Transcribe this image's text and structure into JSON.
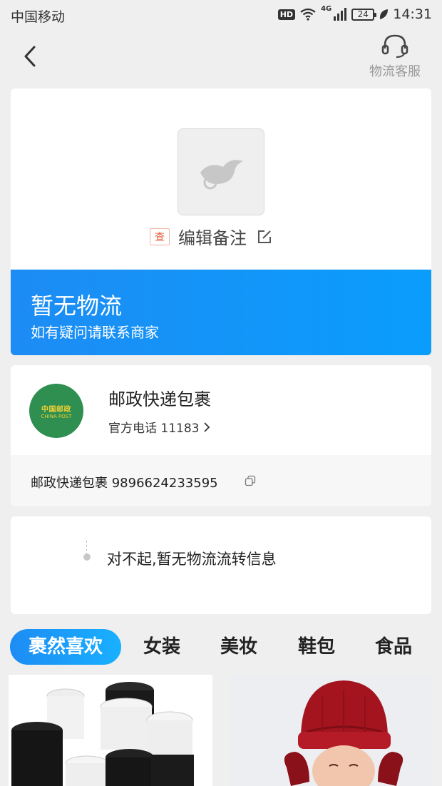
{
  "status_bar": {
    "carrier": "中国移动",
    "hd": "HD",
    "network": "4G",
    "battery": "24",
    "time": "14:31"
  },
  "nav": {
    "service_label": "物流客服"
  },
  "package": {
    "check_tag": "查",
    "note_label": "编辑备注"
  },
  "banner": {
    "title": "暂无物流",
    "subtitle": "如有疑问请联系商家"
  },
  "courier": {
    "logo_cn": "中国邮政",
    "logo_en": "CHINA POST",
    "name": "邮政快递包裹",
    "phone": "官方电话 11183",
    "tracking": "邮政快递包裹 9896624233595"
  },
  "trace": {
    "message": "对不起,暂无物流流转信息"
  },
  "tabs": [
    {
      "label": "裹然喜欢"
    },
    {
      "label": "女装"
    },
    {
      "label": "美妆"
    },
    {
      "label": "鞋包"
    },
    {
      "label": "食品"
    }
  ],
  "colors": {
    "accent_blue": "#1d8cf4",
    "china_post_green": "#2e8f51",
    "background": "#efefef"
  }
}
